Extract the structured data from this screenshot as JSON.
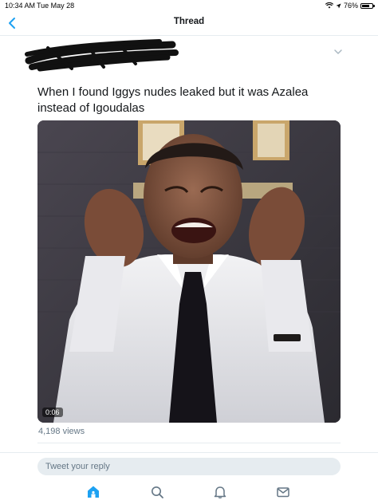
{
  "status_bar": {
    "time": "10:34 AM",
    "date": "Tue May 28",
    "battery": "76%",
    "battery_level": 0.76,
    "icons": [
      "wifi-icon",
      "location-arrow-icon",
      "battery-icon"
    ]
  },
  "nav": {
    "title": "Thread",
    "back_icon": "chevron-left-icon"
  },
  "tweet": {
    "author": "",
    "menu_icon": "chevron-down-icon",
    "text": "When I found Iggys nudes leaked but it was Azalea instead of Igoudalas",
    "media": {
      "type": "video",
      "duration": "0:06"
    },
    "views": "4,198 views"
  },
  "reply": {
    "placeholder": "Tweet your reply"
  },
  "tab_bar": {
    "items": [
      {
        "icon": "home-icon",
        "active": true
      },
      {
        "icon": "search-icon",
        "active": false
      },
      {
        "icon": "bell-icon",
        "active": false
      },
      {
        "icon": "mail-icon",
        "active": false
      }
    ]
  },
  "colors": {
    "accent": "#1da1f2",
    "icon_gray": "#657786",
    "text": "#14171a",
    "divider": "#e6ecf0"
  }
}
